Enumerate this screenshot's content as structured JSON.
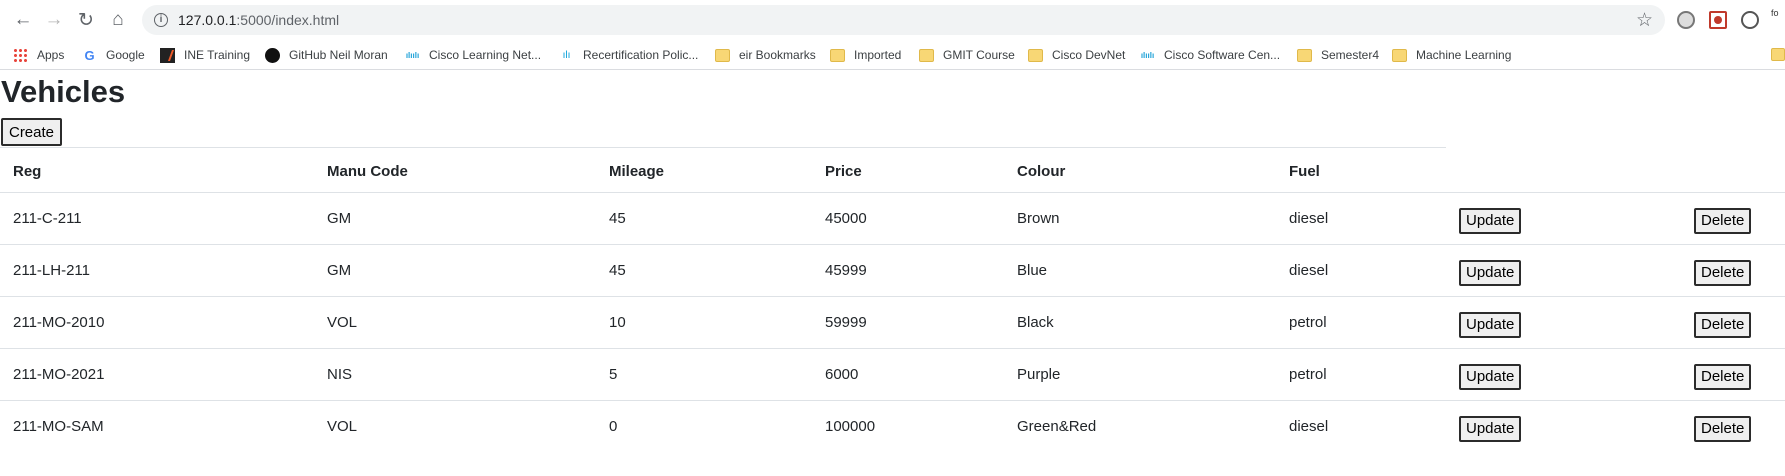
{
  "browser": {
    "url_host": "127.0.0.1",
    "url_path": ":5000/index.html",
    "overflow_text": "fo"
  },
  "bookmarks": [
    {
      "label": "Apps",
      "icon": "apps-grid-icon"
    },
    {
      "label": "Google",
      "icon": "google-icon"
    },
    {
      "label": "INE Training",
      "icon": "ine-icon"
    },
    {
      "label": "GitHub Neil Moran",
      "icon": "github-icon"
    },
    {
      "label": "Cisco Learning Net...",
      "icon": "cisco-icon"
    },
    {
      "label": "Recertification Polic...",
      "icon": "cisco-icon"
    },
    {
      "label": "eir Bookmarks",
      "icon": "folder-icon"
    },
    {
      "label": "Imported",
      "icon": "folder-icon"
    },
    {
      "label": "GMIT Course",
      "icon": "folder-icon"
    },
    {
      "label": "Cisco DevNet",
      "icon": "folder-icon"
    },
    {
      "label": "Cisco Software Cen...",
      "icon": "cisco-icon"
    },
    {
      "label": "Semester4",
      "icon": "folder-icon"
    },
    {
      "label": "Machine Learning",
      "icon": "folder-icon"
    }
  ],
  "page": {
    "title": "Vehicles",
    "create_label": "Create"
  },
  "table": {
    "headers": [
      "Reg",
      "Manu Code",
      "Mileage",
      "Price",
      "Colour",
      "Fuel"
    ],
    "update_label": "Update",
    "delete_label": "Delete",
    "rows": [
      [
        "211-C-211",
        "GM",
        "45",
        "45000",
        "Brown",
        "diesel"
      ],
      [
        "211-LH-211",
        "GM",
        "45",
        "45999",
        "Blue",
        "diesel"
      ],
      [
        "211-MO-2010",
        "VOL",
        "10",
        "59999",
        "Black",
        "petrol"
      ],
      [
        "211-MO-2021",
        "NIS",
        "5",
        "6000",
        "Purple",
        "petrol"
      ],
      [
        "211-MO-SAM",
        "VOL",
        "0",
        "100000",
        "Green&Red",
        "diesel"
      ]
    ]
  }
}
